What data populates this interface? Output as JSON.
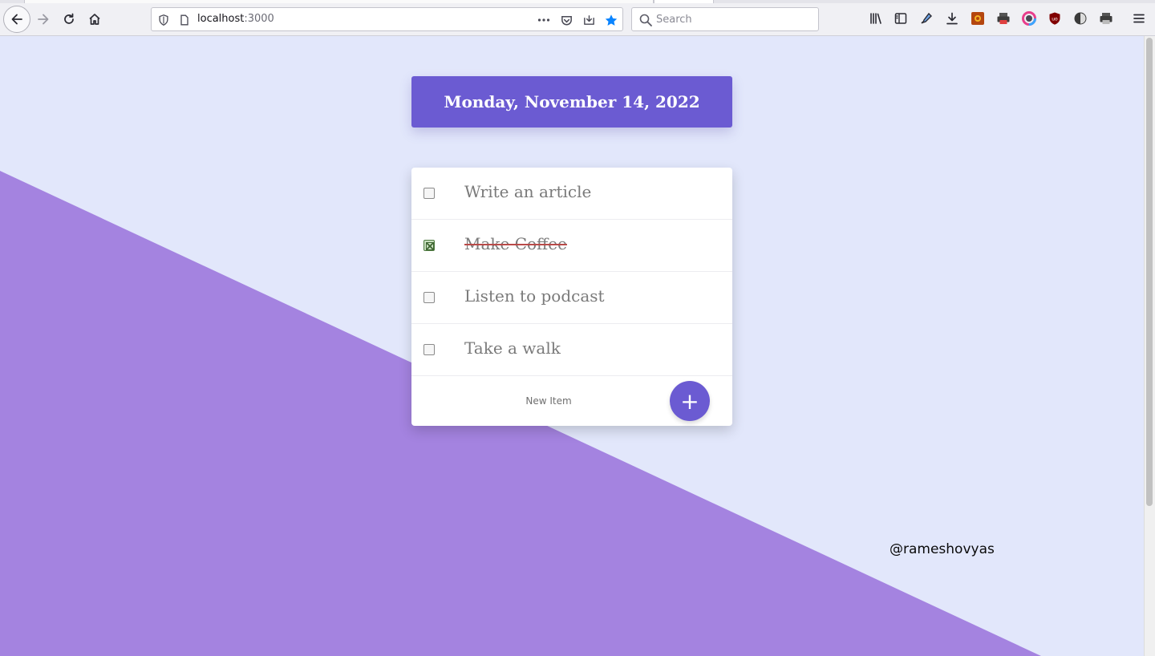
{
  "browser": {
    "url_host": "localhost",
    "url_port": ":3000",
    "search_placeholder": "Search",
    "icons": {
      "back": "back-arrow-icon",
      "forward": "forward-arrow-icon",
      "reload": "reload-icon",
      "home": "home-icon",
      "page_actions": "more-dots-icon",
      "pocket": "pocket-icon",
      "reader": "reader-view-icon",
      "bookmark": "bookmark-star-icon",
      "library": "library-icon",
      "sidebar": "sidebar-icon",
      "eyedropper": "eyedropper-icon",
      "downloads": "download-icon",
      "extensions": [
        "extension-sun-icon",
        "printer-icon",
        "color-circle-icon",
        "ublock-icon",
        "dark-reader-icon",
        "print-icon"
      ],
      "menu": "hamburger-menu-icon"
    },
    "accent": "#0a84ff"
  },
  "page": {
    "date_heading": "Monday, November 14, 2022",
    "todos": [
      {
        "text": "Write an article",
        "done": false
      },
      {
        "text": "Make Coffee",
        "done": true
      },
      {
        "text": "Listen to podcast",
        "done": false
      },
      {
        "text": "Take a walk",
        "done": false
      }
    ],
    "new_item_placeholder": "New Item",
    "add_button_label": "+",
    "handle": "@rameshovyas",
    "colors": {
      "background": "#e2e7fb",
      "diagonal": "#a483e0",
      "primary": "#6b5bd2"
    }
  }
}
